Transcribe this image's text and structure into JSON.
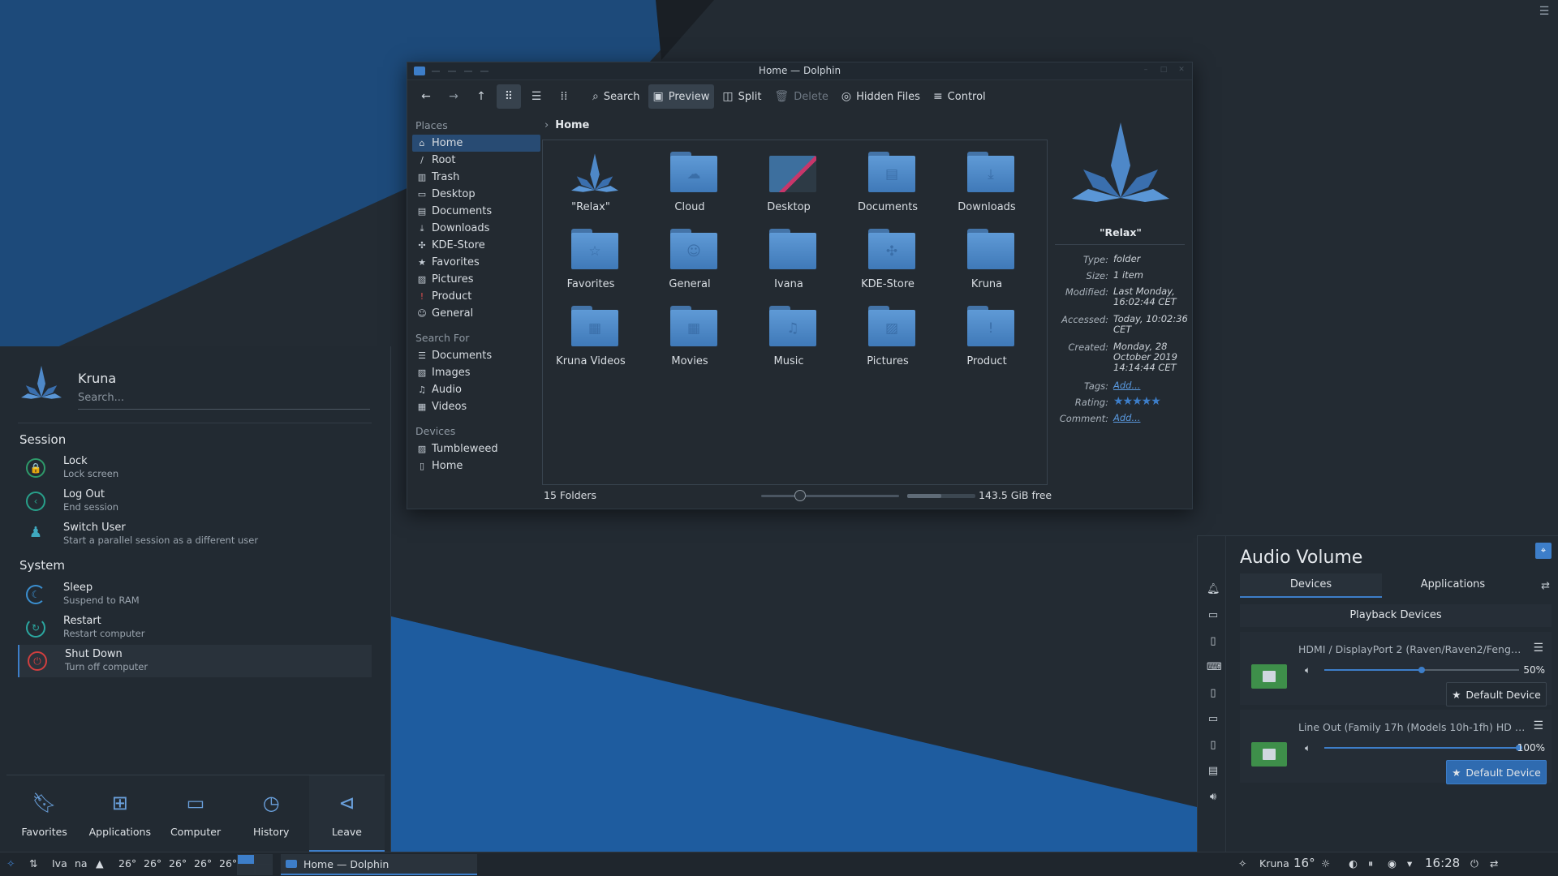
{
  "colors": {
    "accent": "#3d7ec9",
    "panel": "#232a31",
    "wallpaper_dark": "#232b33",
    "wallpaper_blue": "#1d5a9c"
  },
  "desktop": {
    "menu_icon": "hamburger-icon"
  },
  "dolphin": {
    "title": "Home — Dolphin",
    "toolbar": {
      "back_icon": "back-arrow-icon",
      "forward_icon": "forward-arrow-icon",
      "up_icon": "up-arrow-icon",
      "icons_view_icon": "icons-view-icon",
      "details_view_icon": "details-view-icon",
      "compact_view_icon": "compact-view-icon",
      "search": "Search",
      "preview": "Preview",
      "split": "Split",
      "delete": "Delete",
      "hidden_files": "Hidden Files",
      "control": "Control"
    },
    "places": {
      "places_header": "Places",
      "places_items": [
        "Home",
        "Root",
        "Trash",
        "Desktop",
        "Documents",
        "Downloads",
        "KDE-Store",
        "Favorites",
        "Pictures",
        "Product",
        "General"
      ],
      "search_header": "Search For",
      "search_items": [
        "Documents",
        "Images",
        "Audio",
        "Videos"
      ],
      "devices_header": "Devices",
      "devices_items": [
        "Tumbleweed",
        "Home"
      ]
    },
    "breadcrumb": {
      "current": "Home"
    },
    "items": [
      {
        "name": "\"Relax\"",
        "icon": "kruna-logo-icon"
      },
      {
        "name": "Cloud",
        "icon": "cloud-icon"
      },
      {
        "name": "Desktop",
        "icon": "desktop-folder-icon"
      },
      {
        "name": "Documents",
        "icon": "document-icon"
      },
      {
        "name": "Downloads",
        "icon": "download-icon"
      },
      {
        "name": "Favorites",
        "icon": "star-icon"
      },
      {
        "name": "General",
        "icon": "people-icon"
      },
      {
        "name": "Ivana",
        "icon": "folder-icon"
      },
      {
        "name": "KDE-Store",
        "icon": "kde-store-icon"
      },
      {
        "name": "Kruna",
        "icon": "folder-icon"
      },
      {
        "name": "Kruna Videos",
        "icon": "film-icon"
      },
      {
        "name": "Movies",
        "icon": "film-icon"
      },
      {
        "name": "Music",
        "icon": "music-icon"
      },
      {
        "name": "Pictures",
        "icon": "picture-icon"
      },
      {
        "name": "Product",
        "icon": "exclamation-icon"
      }
    ],
    "info": {
      "name": "\"Relax\"",
      "type_k": "Type:",
      "type_v": "folder",
      "size_k": "Size:",
      "size_v": "1 item",
      "modified_k": "Modified:",
      "modified_v": "Last Monday, 16:02:44 CET",
      "accessed_k": "Accessed:",
      "accessed_v": "Today, 10:02:36 CET",
      "created_k": "Created:",
      "created_v": "Monday, 28 October 2019 14:14:44 CET",
      "tags_k": "Tags:",
      "tags_v": "Add...",
      "rating_k": "Rating:",
      "rating_stars": 5,
      "comment_k": "Comment:",
      "comment_v": "Add..."
    },
    "status": {
      "folders": "15 Folders",
      "zoom_fraction": 0.28,
      "used_fraction": 0.5,
      "free": "143.5 GiB free"
    }
  },
  "launcher": {
    "user": "Kruna",
    "search_placeholder": "Search...",
    "session_header": "Session",
    "session": [
      {
        "title": "Lock",
        "sub": "Lock screen",
        "icon": "lock-icon"
      },
      {
        "title": "Log Out",
        "sub": "End session",
        "icon": "logout-icon"
      },
      {
        "title": "Switch User",
        "sub": "Start a parallel session as a different user",
        "icon": "switch-user-icon"
      }
    ],
    "system_header": "System",
    "system": [
      {
        "title": "Sleep",
        "sub": "Suspend to RAM",
        "icon": "sleep-icon"
      },
      {
        "title": "Restart",
        "sub": "Restart computer",
        "icon": "restart-icon"
      },
      {
        "title": "Shut Down",
        "sub": "Turn off computer",
        "icon": "shutdown-icon"
      }
    ],
    "tabs": [
      {
        "label": "Favorites",
        "icon": "bookmark-icon"
      },
      {
        "label": "Applications",
        "icon": "grid-icon"
      },
      {
        "label": "Computer",
        "icon": "monitor-icon"
      },
      {
        "label": "History",
        "icon": "clock-icon"
      },
      {
        "label": "Leave",
        "icon": "leave-icon"
      }
    ]
  },
  "audio": {
    "title": "Audio Volume",
    "tab_devices": "Devices",
    "tab_applications": "Applications",
    "playback_header": "Playback Devices",
    "devices": [
      {
        "name": "HDMI / DisplayPort 2 (Raven/Raven2/Fenghu...",
        "percent_text": "50%",
        "volume": 0.5,
        "default_label": "Default Device",
        "is_default": false
      },
      {
        "name": "Line Out (Family 17h (Models 10h-1fh) HD Aud...",
        "percent_text": "100%",
        "volume": 1.0,
        "default_label": "Default Device",
        "is_default": true
      }
    ]
  },
  "taskbar": {
    "workspace1": "Iva",
    "workspace2": "na",
    "temps": [
      "26°",
      "26°",
      "26°",
      "26°",
      "26°"
    ],
    "task_title": "Home — Dolphin",
    "tray_user": "Kruna",
    "weather_temp": "16°",
    "clock": "16:28"
  }
}
